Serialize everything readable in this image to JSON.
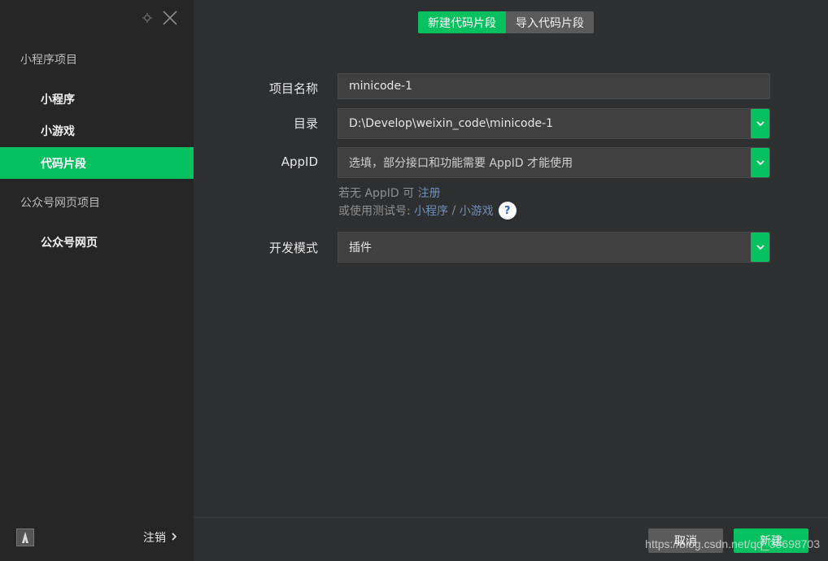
{
  "sidebar": {
    "section_miniprogram": "小程序项目",
    "item_miniprogram": "小程序",
    "item_minigame": "小游戏",
    "item_codesnippet": "代码片段",
    "section_official": "公众号网页项目",
    "item_webpage": "公众号网页",
    "logout": "注销"
  },
  "tabs": {
    "new_snippet": "新建代码片段",
    "import_snippet": "导入代码片段"
  },
  "form": {
    "project_name_label": "项目名称",
    "project_name_value": "minicode-1",
    "directory_label": "目录",
    "directory_value": "D:\\Develop\\weixin_code\\minicode-1",
    "appid_label": "AppID",
    "appid_placeholder": "选填，部分接口和功能需要 AppID 才能使用",
    "hint1_prefix": "若无 AppID 可",
    "hint1_link": "注册",
    "hint2_prefix": "或使用测试号:",
    "hint2_link1": "小程序",
    "hint2_sep": "/",
    "hint2_link2": "小游戏",
    "help": "?",
    "dev_mode_label": "开发模式",
    "dev_mode_value": "插件"
  },
  "buttons": {
    "cancel": "取消",
    "create": "新建"
  },
  "watermark": "https://blog.csdn.net/qq_38698703",
  "colors": {
    "accent": "#07c160",
    "sidebar_bg": "#262626",
    "main_bg": "#2e2f31",
    "link": "#6f8fb8"
  }
}
